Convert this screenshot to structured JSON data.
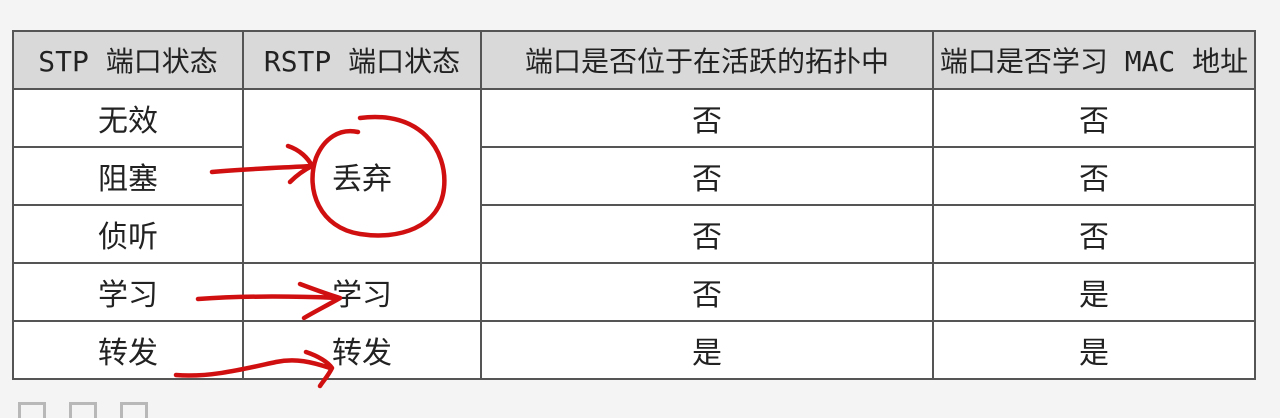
{
  "table": {
    "headers": [
      "STP 端口状态",
      "RSTP 端口状态",
      "端口是否位于在活跃的拓扑中",
      "端口是否学习 MAC 地址"
    ],
    "rows": [
      {
        "stp": "无效",
        "active": "否",
        "learn": "否"
      },
      {
        "stp": "阻塞",
        "active": "否",
        "learn": "否"
      },
      {
        "stp": "侦听",
        "active": "否",
        "learn": "否"
      },
      {
        "stp": "学习",
        "rstp": "学习",
        "active": "否",
        "learn": "是"
      },
      {
        "stp": "转发",
        "rstp": "转发",
        "active": "是",
        "learn": "是"
      }
    ],
    "rstp_discard": "丢弃"
  },
  "annotation_color": "#d01010"
}
